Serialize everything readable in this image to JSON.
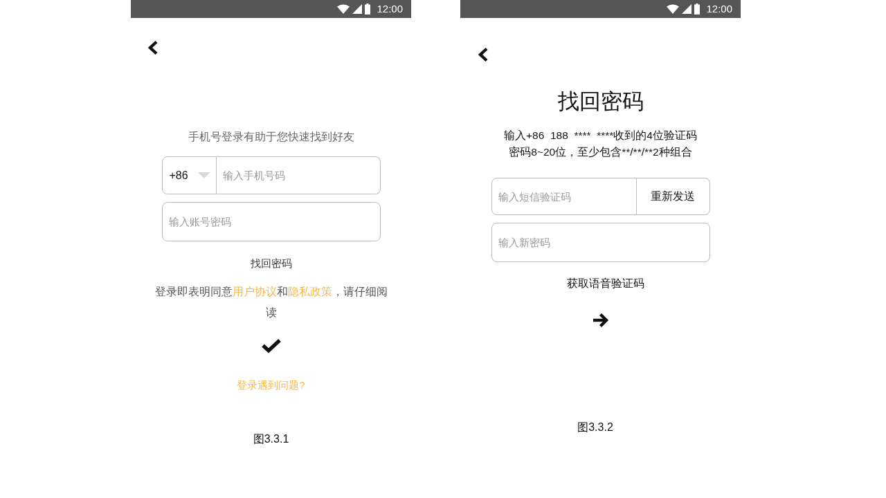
{
  "login_screen": {
    "status_bar": {
      "time": "12:00"
    },
    "subtitle": "手机号登录有助于您快速找到好友",
    "phone_field": {
      "country_code": "+86",
      "placeholder": "输入手机号码"
    },
    "password_field": {
      "placeholder": "输入账号密码"
    },
    "forgot_password_link": "找回密码",
    "agreement": [
      {
        "kind": "plain",
        "text": "登录即表明同意"
      },
      {
        "kind": "link",
        "text": "用户协议"
      },
      {
        "kind": "plain",
        "text": "和"
      },
      {
        "kind": "link",
        "text": "隐私政策"
      },
      {
        "kind": "plain",
        "text": "，请仔细阅读"
      }
    ],
    "help_link": "登录遇到问题?",
    "caption": "图3.3.1"
  },
  "reset_password_screen": {
    "status_bar": {
      "time": "12:00"
    },
    "title": "找回密码",
    "hint_lines": [
      "输入+86  188  ****  ****收到的4位验证码",
      "密码8~20位，至少包含**/**/**2种组合"
    ],
    "code_field": {
      "placeholder": "输入短信验证码"
    },
    "resend_button": "重新发送",
    "new_password_field": {
      "placeholder": "输入新密码"
    },
    "voice_code_link": "获取语音验证码",
    "caption": "图3.3.2"
  }
}
